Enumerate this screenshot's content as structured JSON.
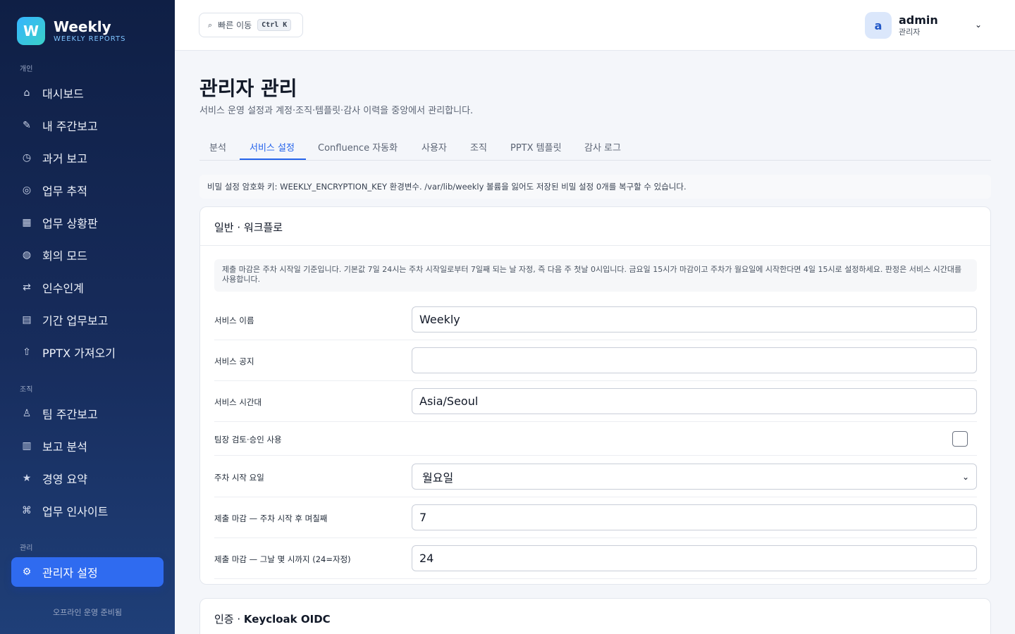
{
  "brand": {
    "logo_letter": "W",
    "name": "Weekly",
    "subtitle": "WEEKLY REPORTS"
  },
  "sidebar": {
    "section_personal": "개인",
    "personal_items": [
      {
        "label": "대시보드",
        "icon": "⌂"
      },
      {
        "label": "내 주간보고",
        "icon": "✎"
      },
      {
        "label": "과거 보고",
        "icon": "◷"
      },
      {
        "label": "업무 추적",
        "icon": "◎"
      },
      {
        "label": "업무 상황판",
        "icon": "▦"
      },
      {
        "label": "회의 모드",
        "icon": "◍"
      },
      {
        "label": "인수인계",
        "icon": "⇄"
      },
      {
        "label": "기간 업무보고",
        "icon": "▤"
      },
      {
        "label": "PPTX 가져오기",
        "icon": "⇧"
      }
    ],
    "section_org": "조직",
    "org_items": [
      {
        "label": "팀 주간보고",
        "icon": "♙"
      },
      {
        "label": "보고 분석",
        "icon": "▥"
      },
      {
        "label": "경영 요약",
        "icon": "★"
      },
      {
        "label": "업무 인사이트",
        "icon": "⌘"
      }
    ],
    "section_admin": "관리",
    "admin_items": [
      {
        "label": "관리자 설정",
        "icon": "⚙",
        "active": true
      }
    ],
    "footer": "오프라인 운영 준비됨"
  },
  "topbar": {
    "quick_jump_icon": "⌕",
    "quick_jump_label": "빠른 이동",
    "quick_jump_shortcut": "Ctrl K",
    "user": {
      "avatar_letter": "a",
      "name": "admin",
      "role": "관리자",
      "chevron": "⌄"
    }
  },
  "page": {
    "title": "관리자 관리",
    "description": "서비스 운영 설정과 계정·조직·템플릿·감사 이력을 중앙에서 관리합니다."
  },
  "tabs": [
    {
      "label": "분석",
      "active": false
    },
    {
      "label": "서비스 설정",
      "active": true
    },
    {
      "label": "Confluence 자동화",
      "active": false
    },
    {
      "label": "사용자",
      "active": false
    },
    {
      "label": "조직",
      "active": false
    },
    {
      "label": "PPTX 템플릿",
      "active": false
    },
    {
      "label": "감사 로그",
      "active": false
    }
  ],
  "encryption_notice": "비밀 설정 암호화 키: WEEKLY_ENCRYPTION_KEY 환경변수. /var/lib/weekly 볼륨을 잃어도 저장된 비밀 설정 0개를 복구할 수 있습니다.",
  "general_section": {
    "title_prefix": "일반 · 워크플로",
    "notice": "제출 마감은 주차 시작일 기준입니다. 기본값 7일 24시는 주차 시작일로부터 7일째 되는 날 자정, 즉 다음 주 첫날 0시입니다. 금요일 15시가 마감이고 주차가 월요일에 시작한다면 4일 15시로 설정하세요. 판정은 서비스 시간대를 사용합니다.",
    "fields": {
      "service_name": {
        "label": "서비스 이름",
        "value": "Weekly"
      },
      "service_notice": {
        "label": "서비스 공지",
        "value": ""
      },
      "service_timezone": {
        "label": "서비스 시간대",
        "value": "Asia/Seoul"
      },
      "team_lead_approval": {
        "label": "팀장 검토·승인 사용",
        "checked": false
      },
      "week_start_day": {
        "label": "주차 시작 요일",
        "value": "월요일"
      },
      "deadline_day": {
        "label": "제출 마감 — 주차 시작 후 며칠째",
        "value": "7"
      },
      "deadline_hour": {
        "label": "제출 마감 — 그날 몇 시까지 (24=자정)",
        "value": "24"
      }
    }
  },
  "auth_section": {
    "title_prefix": "인증 · ",
    "title_bold": "Keycloak OIDC"
  }
}
